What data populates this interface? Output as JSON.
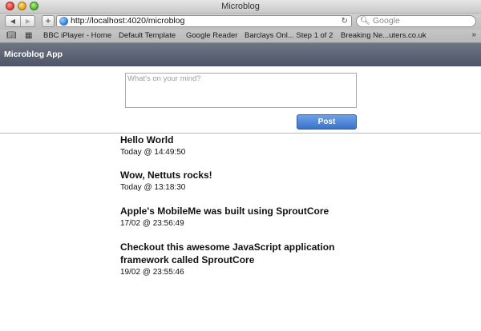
{
  "window": {
    "title": "Microblog"
  },
  "toolbar": {
    "url": "http://localhost:4020/microblog",
    "search_placeholder": "Google"
  },
  "bookmarks": {
    "items": [
      "BBC iPlayer - Home",
      "Default Template",
      "Google Reader",
      "Barclays Onl... Step 1 of 2",
      "Breaking Ne...uters.co.uk"
    ]
  },
  "app": {
    "title": "Microblog App",
    "compose_placeholder": "What's on your mind?",
    "post_label": "Post"
  },
  "posts": [
    {
      "title": "Hello World",
      "time": "Today @ 14:49:50"
    },
    {
      "title": "Wow, Nettuts rocks!",
      "time": "Today @ 13:18:30"
    },
    {
      "title": "Apple's MobileMe was built using SproutCore",
      "time": "17/02 @ 23:56:49"
    },
    {
      "title": "Checkout this awesome JavaScript application framework called SproutCore",
      "time": "19/02 @ 23:55:46"
    }
  ]
}
